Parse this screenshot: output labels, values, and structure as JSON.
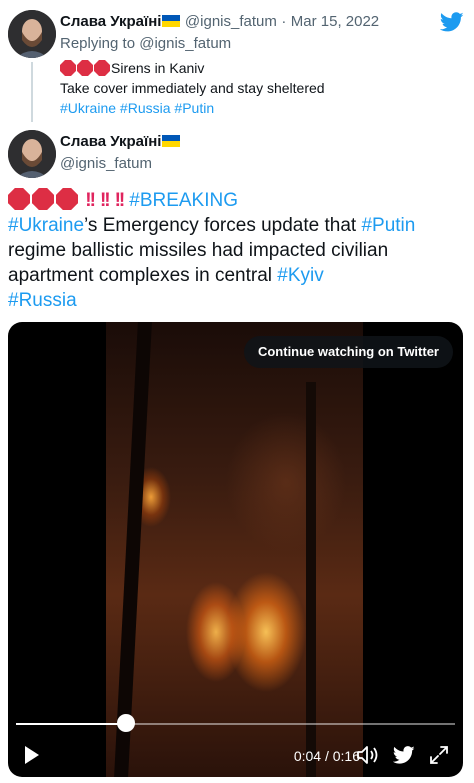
{
  "first_tweet": {
    "display_name": "Слава Україні",
    "handle": "@ignis_fatum",
    "separator": "·",
    "date": "Mar 15, 2022",
    "replying_prefix": "Replying to",
    "replying_handle": "@ignis_fatum",
    "line1": "Sirens in Kaniv",
    "line2": "Take cover immediately and stay sheltered",
    "hashtags": [
      "#Ukraine",
      "#Russia",
      "#Putin"
    ]
  },
  "second_tweet": {
    "display_name": "Слава Україні",
    "handle": "@ignis_fatum",
    "breaking_tag": "#BREAKING",
    "body": {
      "tag_ukraine": "#Ukraine",
      "text1": "’s Emergency forces update that ",
      "tag_putin": "#Putin",
      "text2": "regime ballistic missiles had impacted civilian apartment complexes in central ",
      "tag_kyiv": "#Kyiv",
      "tag_russia": "#Russia"
    }
  },
  "video": {
    "continue_label": "Continue watching on Twitter",
    "current_time": "0:04",
    "time_separator": "/",
    "duration": "0:16",
    "progress_fraction": 0.25
  },
  "icons": {
    "brand": "twitter-bird-icon",
    "alarm": "stop-sign-icon",
    "exclaim": "double-exclamation-icon",
    "play": "play-icon",
    "volume": "volume-icon",
    "fullscreen": "fullscreen-icon"
  },
  "colors": {
    "link": "#1d9bf0",
    "text": "#0f1419",
    "secondary": "#536471",
    "alarm_red": "#e0245e"
  }
}
